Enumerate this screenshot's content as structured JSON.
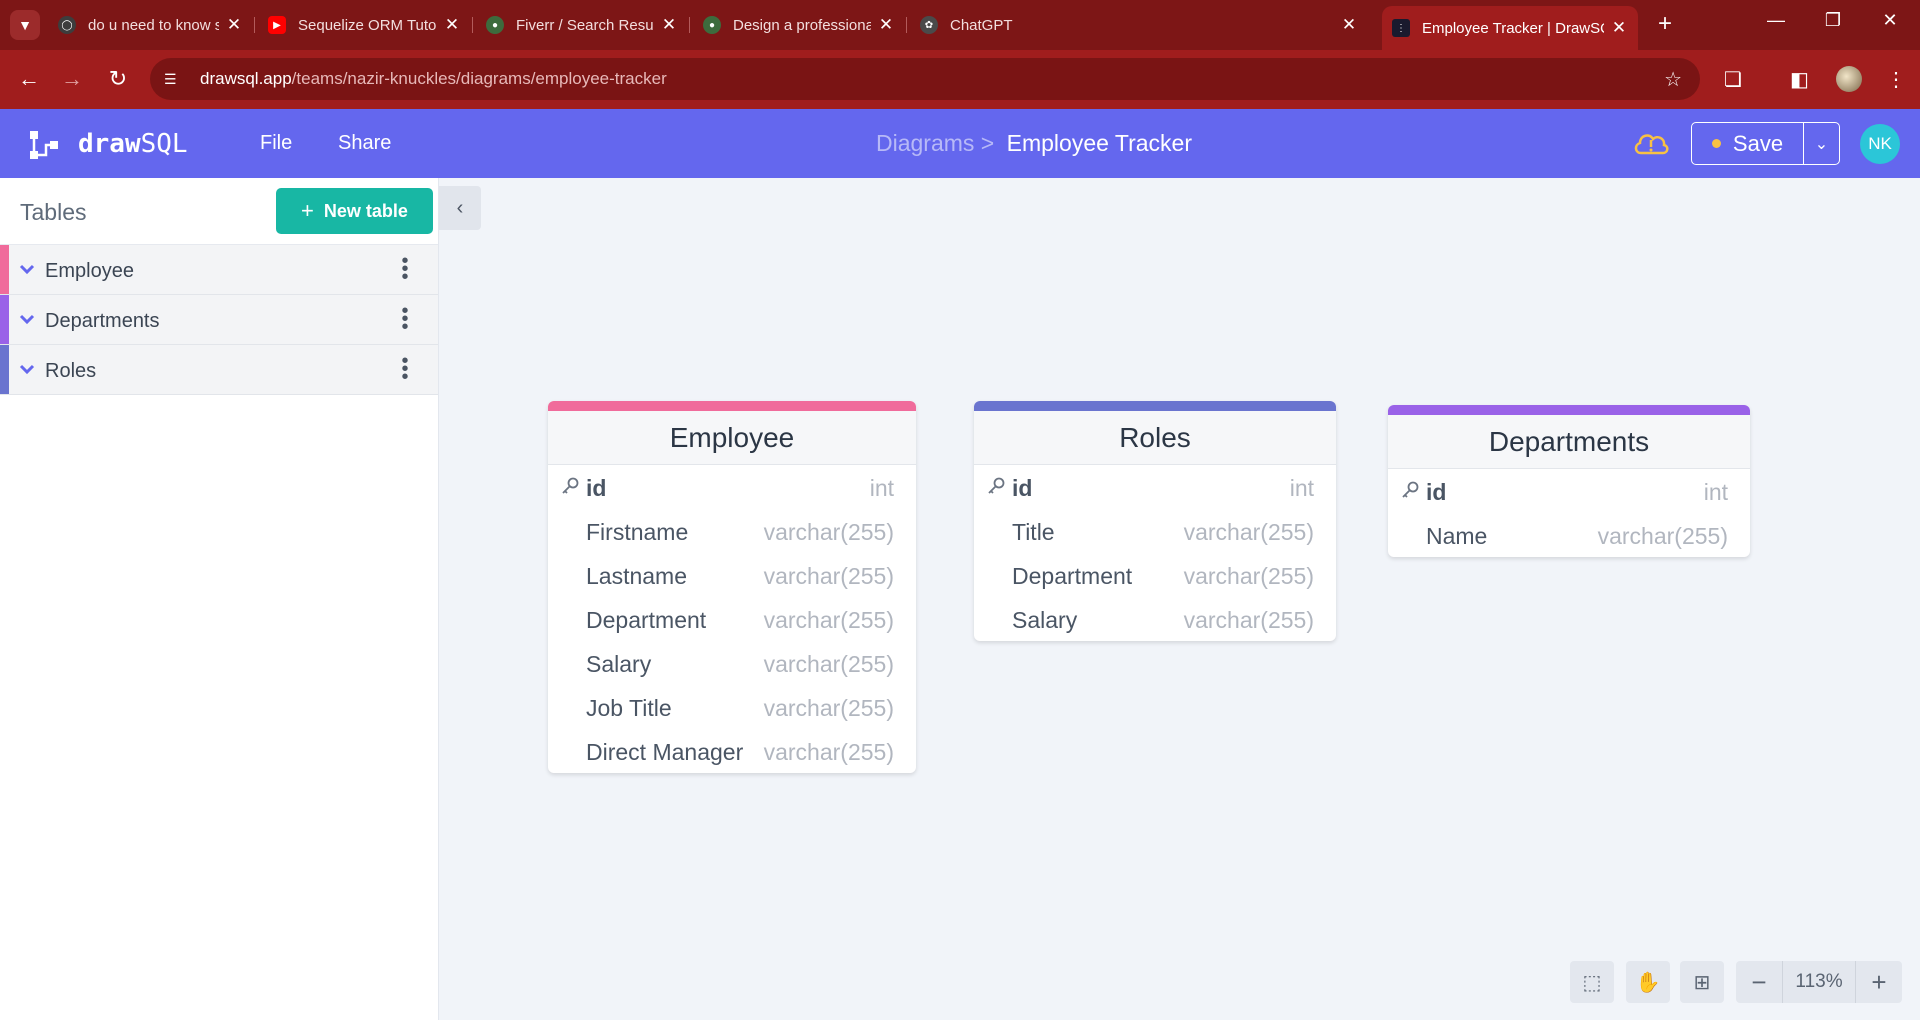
{
  "browser": {
    "tabs": [
      {
        "title": "do u need to know sequali",
        "favicon_color": "#3d3d3d",
        "active": false
      },
      {
        "title": "Sequelize ORM Tutorial (all",
        "favicon_color": "#ff0000",
        "active": false
      },
      {
        "title": "Fiverr / Search Results for \"",
        "favicon_color": "#3d6b3d",
        "active": false
      },
      {
        "title": "Design a professional word",
        "favicon_color": "#3d6b3d",
        "active": false
      },
      {
        "title": "ChatGPT",
        "favicon_color": "#4a4a4a",
        "active": false
      },
      {
        "title": "Employee Tracker | DrawSQ",
        "favicon_color": "#1a1a2e",
        "active": true
      }
    ],
    "url_host": "drawsql.app",
    "url_path": "/teams/nazir-knuckles/diagrams/employee-tracker"
  },
  "app": {
    "logo_bold": "draw",
    "logo_light": "SQL",
    "menu": {
      "file": "File",
      "share": "Share"
    },
    "breadcrumb_parent": "Diagrams >",
    "breadcrumb_current": "Employee Tracker",
    "save_label": "Save",
    "avatar_initials": "NK",
    "colors": {
      "header": "#6467ee",
      "accent_teal": "#18b7a4",
      "browser_red": "#a01d1d"
    }
  },
  "sidebar": {
    "title": "Tables",
    "new_table_label": "New table",
    "items": [
      {
        "label": "Employee",
        "color": "#f06b9b"
      },
      {
        "label": "Departments",
        "color": "#9a62e8"
      },
      {
        "label": "Roles",
        "color": "#6a74cf"
      }
    ]
  },
  "tables": [
    {
      "name": "Employee",
      "color": "#f06b9b",
      "columns": [
        {
          "name": "id",
          "type": "int",
          "pk": true
        },
        {
          "name": "Firstname",
          "type": "varchar(255)",
          "pk": false
        },
        {
          "name": "Lastname",
          "type": "varchar(255)",
          "pk": false
        },
        {
          "name": "Department",
          "type": "varchar(255)",
          "pk": false
        },
        {
          "name": "Salary",
          "type": "varchar(255)",
          "pk": false
        },
        {
          "name": "Job Title",
          "type": "varchar(255)",
          "pk": false
        },
        {
          "name": "Direct Manager",
          "type": "varchar(255)",
          "pk": false
        }
      ]
    },
    {
      "name": "Roles",
      "color": "#6a74cf",
      "columns": [
        {
          "name": "id",
          "type": "int",
          "pk": true
        },
        {
          "name": "Title",
          "type": "varchar(255)",
          "pk": false
        },
        {
          "name": "Department",
          "type": "varchar(255)",
          "pk": false
        },
        {
          "name": "Salary",
          "type": "varchar(255)",
          "pk": false
        }
      ]
    },
    {
      "name": "Departments",
      "color": "#9a62e8",
      "columns": [
        {
          "name": "id",
          "type": "int",
          "pk": true
        },
        {
          "name": "Name",
          "type": "varchar(255)",
          "pk": false
        }
      ]
    }
  ],
  "toolbar": {
    "zoom": "113%",
    "icons": [
      "select-area-icon",
      "hand-pan-icon",
      "grid-icon",
      "zoom-out-icon",
      "zoom-in-icon"
    ]
  }
}
